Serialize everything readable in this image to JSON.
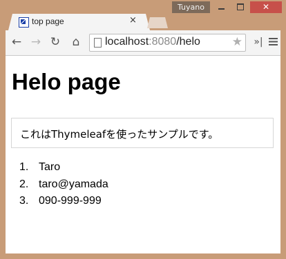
{
  "window": {
    "user_badge": "Tuyano",
    "close_glyph": "✕"
  },
  "tab": {
    "title": "top page",
    "close_glyph": "×",
    "favicon": "page-favicon-icon"
  },
  "toolbar": {
    "back_icon": "←",
    "forward_icon": "→",
    "reload_icon": "↻",
    "home_icon": "⌂",
    "extensions_icon": "»|",
    "star_icon": "★"
  },
  "address_bar": {
    "host": "localhost",
    "port": ":8080",
    "path": "/helo"
  },
  "page": {
    "heading": "Helo page",
    "notice": "これはThymeleafを使ったサンプルです。",
    "items": [
      {
        "number": "1.",
        "text": "Taro"
      },
      {
        "number": "2.",
        "text": "taro@yamada"
      },
      {
        "number": "3.",
        "text": "090-999-999"
      }
    ]
  },
  "colors": {
    "frame": "#c89c78",
    "close_button": "#c7504a",
    "badge": "#7d6a5a",
    "toolbar": "#f4f4f4"
  }
}
